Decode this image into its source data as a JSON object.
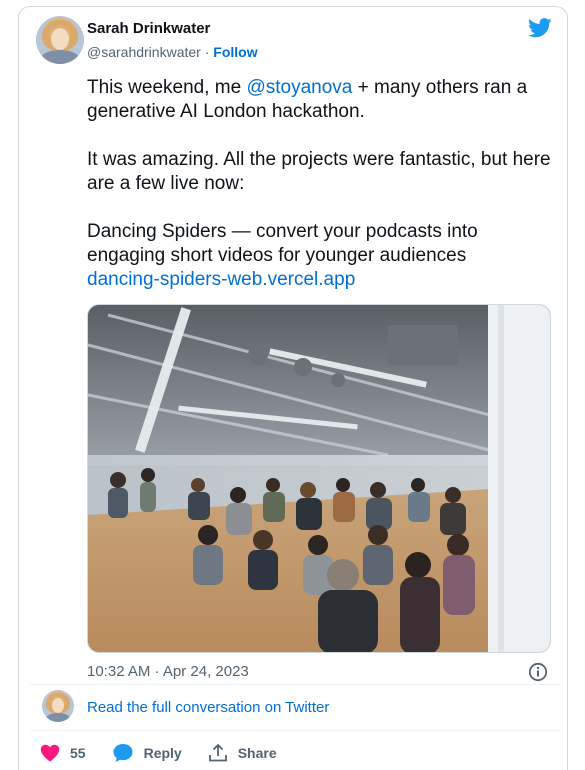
{
  "author": {
    "name": "Sarah Drinkwater",
    "handle": "@sarahdrinkwater",
    "separator": "·",
    "follow_label": "Follow"
  },
  "tweet": {
    "line1_prefix": "This weekend, me ",
    "mention": "@stoyanova",
    "line1_suffix": "  + many others ran a generative AI London hackathon.",
    "paragraph2": "It was amazing. All the projects were fantastic, but here are a few live now:",
    "paragraph3": "Dancing Spiders — convert your podcasts into engaging short videos for younger audiences",
    "link": "dancing-spiders-web.vercel.app"
  },
  "photo": {
    "description_icon": "hackathon-audience-photo"
  },
  "timestamp": "10:32 AM · Apr 24, 2023",
  "read_more": "Read the full conversation on Twitter",
  "actions": {
    "like_count": "55",
    "reply_label": "Reply",
    "share_label": "Share"
  },
  "colors": {
    "brand_blue": "#1d9bf0",
    "link_blue": "#006fd6",
    "like_red": "#f91880",
    "muted": "#536471"
  }
}
